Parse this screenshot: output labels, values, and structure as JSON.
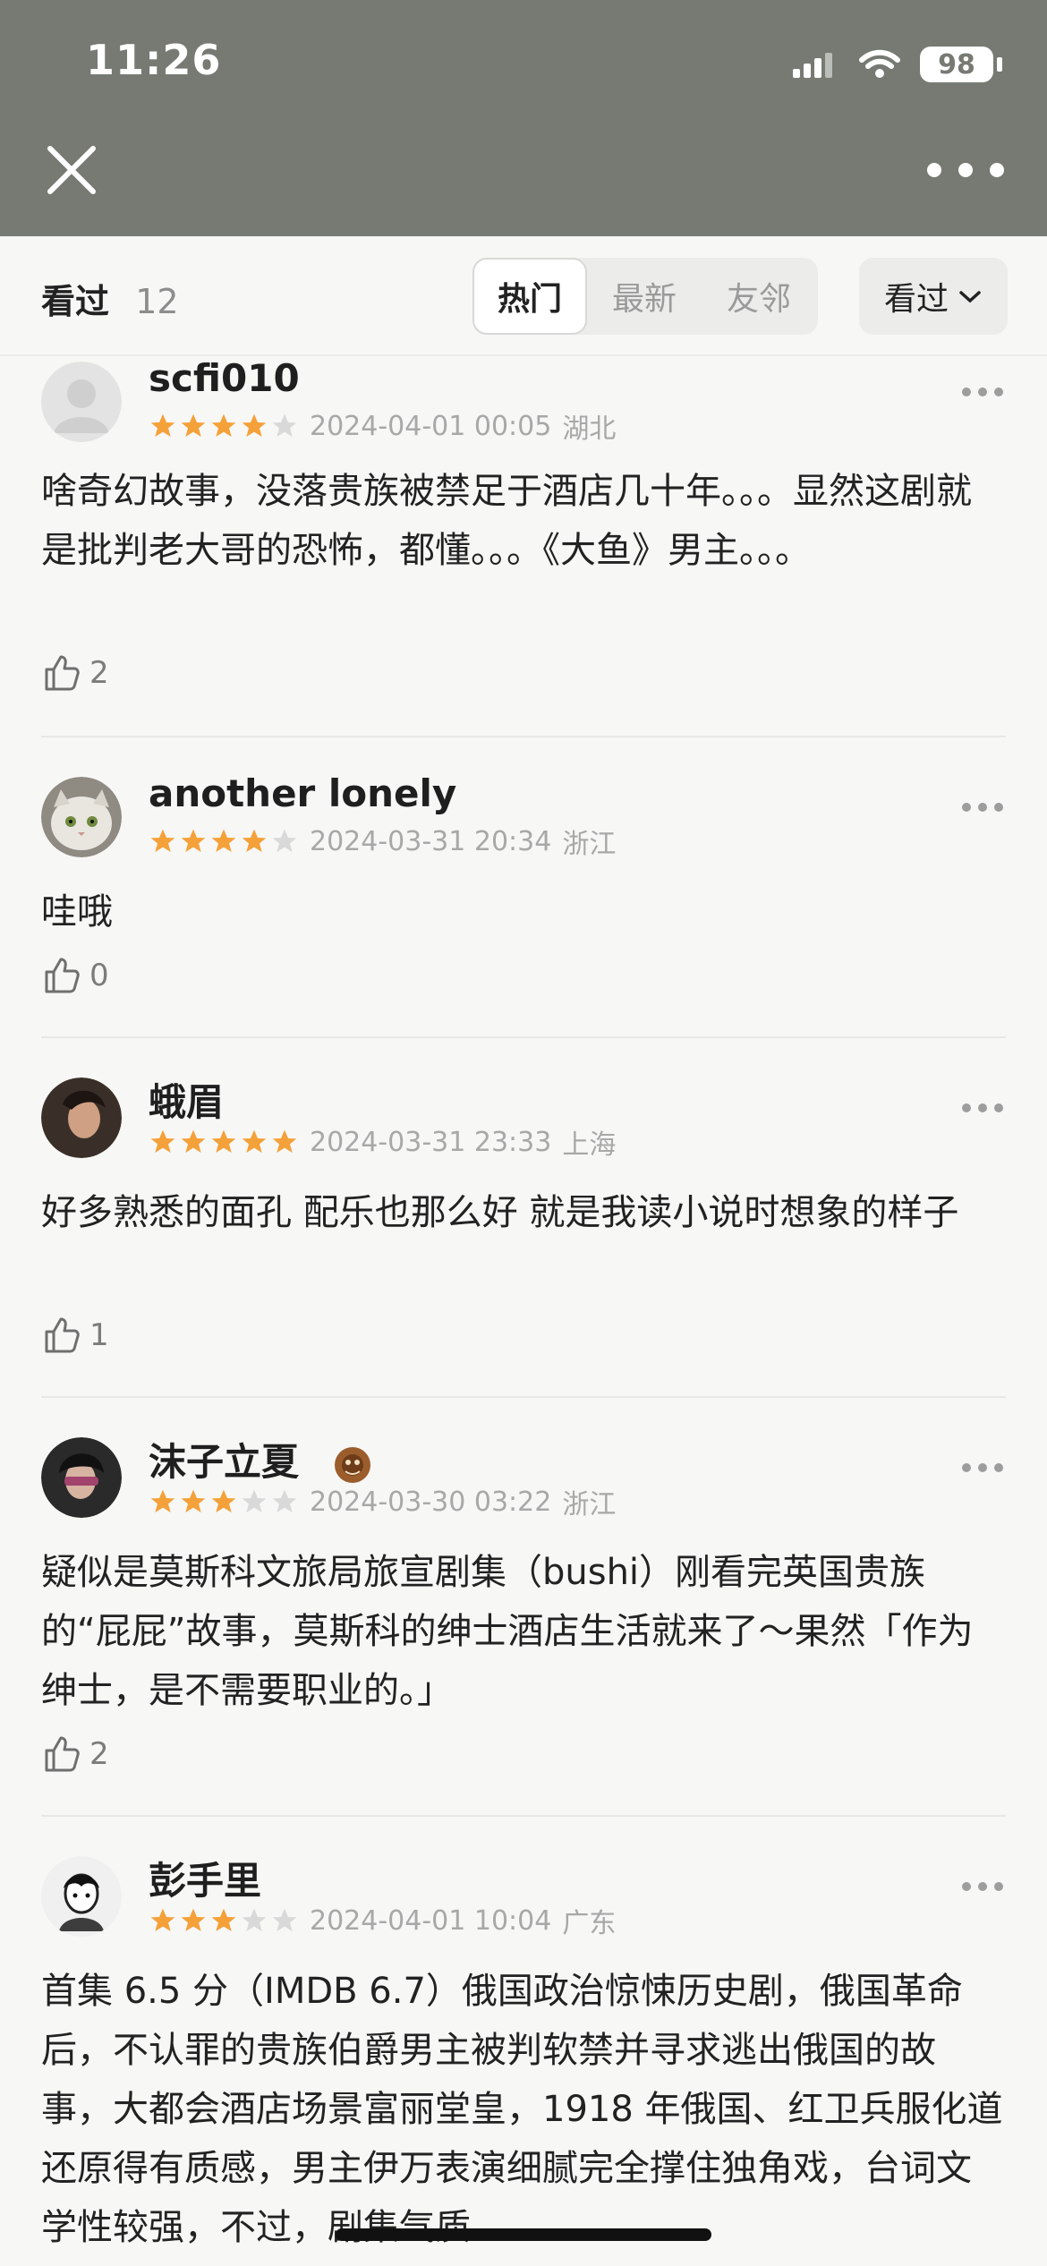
{
  "status": {
    "time": "11:26",
    "battery": "98"
  },
  "filter": {
    "watched_label": "看过",
    "count": "12",
    "tabs": [
      "热门",
      "最新",
      "友邻"
    ],
    "dropdown_label": "看过"
  },
  "reviews": [
    {
      "user": "scfi010",
      "rating": 4,
      "date": "2024-04-01 00:05",
      "region": "湖北",
      "content": "啥奇幻故事，没落贵族被禁足于酒店几十年。。。显然这剧就是批判老大哥的恐怖，都懂。。。《大鱼》男主。。。",
      "likes": "2"
    },
    {
      "user": "another lonely",
      "rating": 4,
      "date": "2024-03-31 20:34",
      "region": "浙江",
      "content": "哇哦",
      "likes": "0"
    },
    {
      "user": "蛾眉",
      "rating": 5,
      "date": "2024-03-31 23:33",
      "region": "上海",
      "content": "好多熟悉的面孔 配乐也那么好 就是我读小说时想象的样子",
      "likes": "1"
    },
    {
      "user": "沫子立夏",
      "rating": 3,
      "date": "2024-03-30 03:22",
      "region": "浙江",
      "content": "疑似是莫斯科文旅局旅宣剧集（bushi）刚看完英国贵族的“屁屁”故事，莫斯科的绅士酒店生活就来了～果然「作为绅士，是不需要职业的。」",
      "likes": "2"
    },
    {
      "user": "彭手里",
      "rating": 3,
      "date": "2024-04-01 10:04",
      "region": "广东",
      "content": "首集 6.5 分（IMDB 6.7）俄国政治惊悚历史剧，俄国革命后，不认罪的贵族伯爵男主被判软禁并寻求逃出俄国的故事，大都会酒店场景富丽堂皇，1918 年俄国、红卫兵服化道还原得有质感，男主伊万表演细腻完全撑住独角戏，台词文学性较强，不过，剧集气质",
      "likes": ""
    }
  ],
  "colors": {
    "header": "#767a73",
    "star": "#f4a13a",
    "star_empty": "#d9d9d9"
  }
}
